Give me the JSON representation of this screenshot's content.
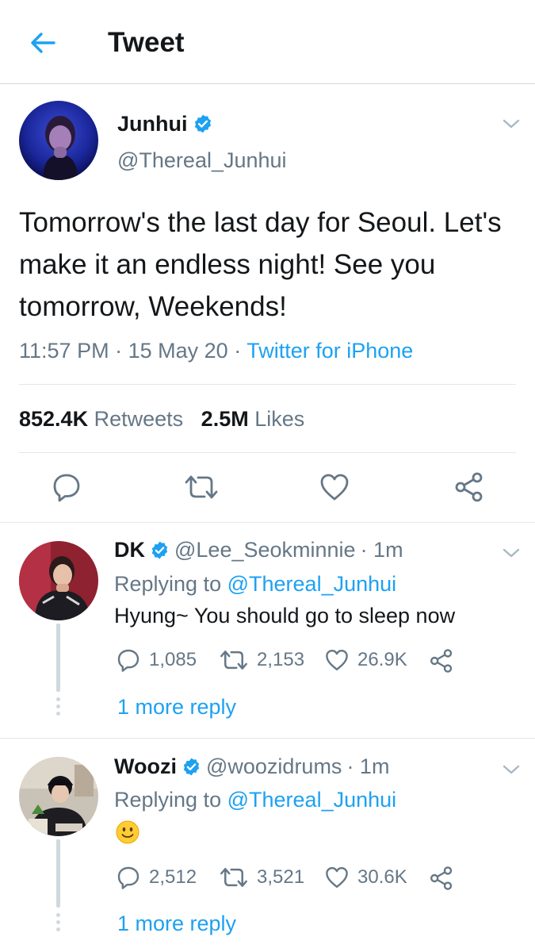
{
  "header": {
    "title": "Tweet",
    "back_icon": "arrow-left-icon"
  },
  "tweet": {
    "name": "Junhui",
    "handle": "@Thereal_Junhui",
    "text": "Tomorrow's the last day for Seoul. Let's make it an endless night! See you tomorrow, Weekends!",
    "time": "11:57 PM",
    "date": "15 May 20",
    "sep": "·",
    "source": "Twitter for iPhone",
    "retweets_count": "852.4K",
    "retweets_label": "Retweets",
    "likes_count": "2.5M",
    "likes_label": "Likes"
  },
  "replies": [
    {
      "name": "DK",
      "handle": "@Lee_Seokminnie",
      "age": "· 1m",
      "replying_prefix": "Replying to",
      "replying_to": "@Thereal_Junhui",
      "text": "Hyung~ You should go to sleep now",
      "reply_count": "1,085",
      "retweet_count": "2,153",
      "like_count": "26.9K",
      "more": "1 more reply"
    },
    {
      "name": "Woozi",
      "handle": "@woozidrums",
      "age": "· 1m",
      "replying_prefix": "Replying to",
      "replying_to": "@Thereal_Junhui",
      "text_emoji": "slightly-smiling-face-icon",
      "reply_count": "2,512",
      "retweet_count": "3,521",
      "like_count": "30.6K",
      "more": "1 more reply"
    }
  ],
  "colors": {
    "accent": "#1da1f2",
    "secondary_text": "#657786",
    "primary_text": "#14171a",
    "divider": "#e1e8ed"
  }
}
